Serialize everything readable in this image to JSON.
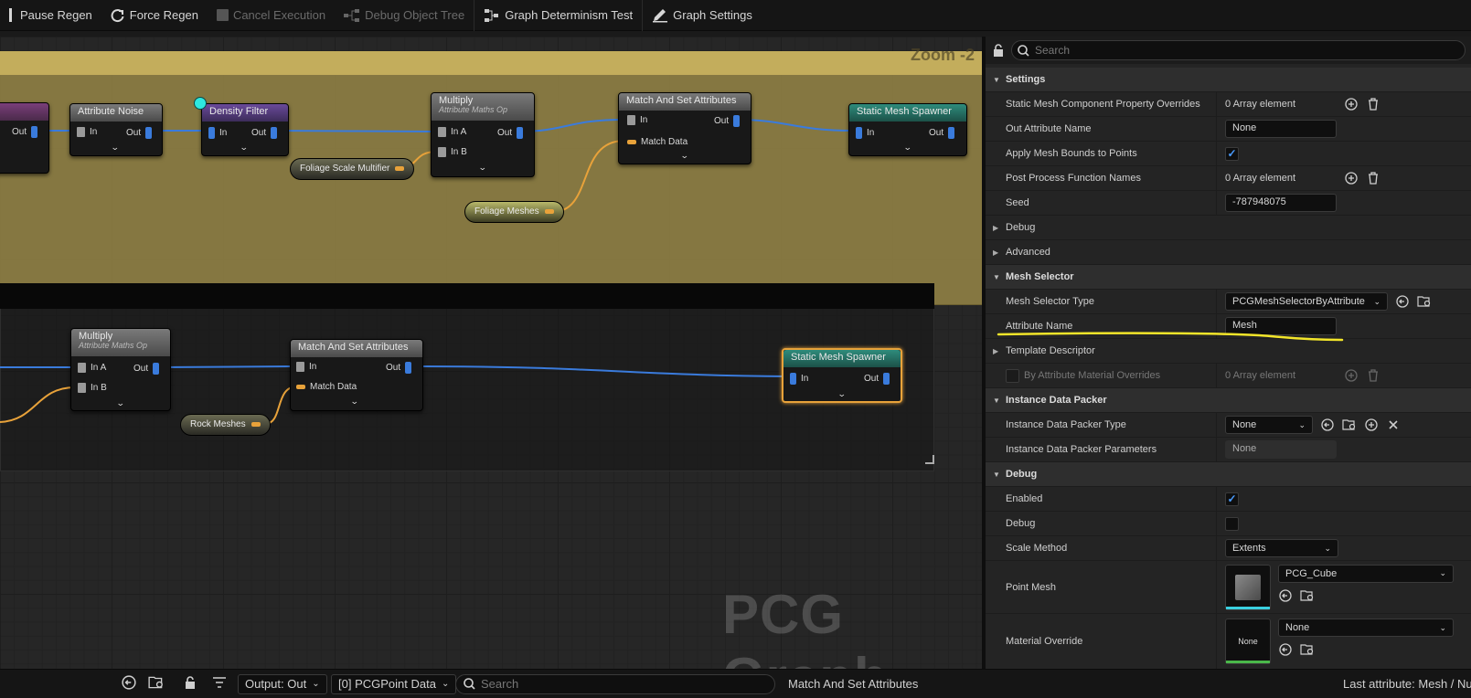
{
  "toolbar": {
    "pause_regen": "Pause Regen",
    "force_regen": "Force Regen",
    "cancel_execution": "Cancel Execution",
    "debug_object_tree": "Debug Object Tree",
    "determinism_test": "Graph Determinism Test",
    "graph_settings": "Graph Settings"
  },
  "graph": {
    "zoom": "Zoom -2",
    "watermark": "PCG Graph",
    "nodes": {
      "attribute_noise": {
        "title": "Attribute Noise",
        "in": "In",
        "out": "Out"
      },
      "left_partial": {
        "out": "Out"
      },
      "density_filter": {
        "title": "Density Filter",
        "in": "In",
        "out": "Out"
      },
      "multiply_top": {
        "title": "Multiply",
        "subtitle": "Attribute Maths Op",
        "in_a": "In A",
        "in_b": "In B",
        "out": "Out"
      },
      "match_top": {
        "title": "Match And Set Attributes",
        "in": "In",
        "match_data": "Match Data",
        "out": "Out"
      },
      "spawner_top": {
        "title": "Static Mesh Spawner",
        "in": "In",
        "out": "Out"
      },
      "multiply_bottom": {
        "title": "Multiply",
        "subtitle": "Attribute Maths Op",
        "in_a": "In A",
        "in_b": "In B",
        "out": "Out"
      },
      "match_bottom": {
        "title": "Match And Set Attributes",
        "in": "In",
        "match_data": "Match Data",
        "out": "Out"
      },
      "spawner_bottom": {
        "title": "Static Mesh Spawner",
        "in": "In",
        "out": "Out"
      }
    },
    "vars": {
      "foliage_scale": "Foliage Scale Multifier",
      "foliage_meshes": "Foliage Meshes",
      "rock_meshes": "Rock Meshes"
    }
  },
  "details": {
    "search_placeholder": "Search",
    "settings": {
      "header": "Settings",
      "smc_overrides": {
        "label": "Static Mesh Component Property Overrides",
        "value": "0 Array element"
      },
      "out_attr_name": {
        "label": "Out Attribute Name",
        "value": "None"
      },
      "apply_mesh_bounds": {
        "label": "Apply Mesh Bounds to Points",
        "checked": true
      },
      "post_process": {
        "label": "Post Process Function Names",
        "value": "0 Array element"
      },
      "seed": {
        "label": "Seed",
        "value": "-787948075"
      },
      "debug": "Debug",
      "advanced": "Advanced"
    },
    "mesh_selector": {
      "header": "Mesh Selector",
      "type": {
        "label": "Mesh Selector Type",
        "value": "PCGMeshSelectorByAttribute"
      },
      "attr_name": {
        "label": "Attribute Name",
        "value": "Mesh"
      },
      "template": "Template Descriptor",
      "by_attr_mat": {
        "label": "By Attribute Material Overrides",
        "value": "0 Array element"
      }
    },
    "instance_packer": {
      "header": "Instance Data Packer",
      "type": {
        "label": "Instance Data Packer Type",
        "value": "None"
      },
      "params": {
        "label": "Instance Data Packer Parameters",
        "value": "None"
      }
    },
    "debug": {
      "header": "Debug",
      "enabled": {
        "label": "Enabled",
        "checked": true
      },
      "debug": {
        "label": "Debug",
        "checked": false
      },
      "scale_method": {
        "label": "Scale Method",
        "value": "Extents"
      },
      "point_mesh": {
        "label": "Point Mesh",
        "value": "PCG_Cube"
      },
      "material_override": {
        "label": "Material Override",
        "value": "None",
        "thumb": "None"
      }
    }
  },
  "statusbar": {
    "output": "Output: Out",
    "pin": "[0] PCGPoint Data",
    "search_placeholder": "Search",
    "node_name": "Match And Set Attributes",
    "last_attribute": "Last attribute: Mesh / Nu"
  },
  "colors": {
    "highlight_underline": "#f2e52a",
    "selected_node": "#e8a23a",
    "check": "#4a9cff"
  }
}
